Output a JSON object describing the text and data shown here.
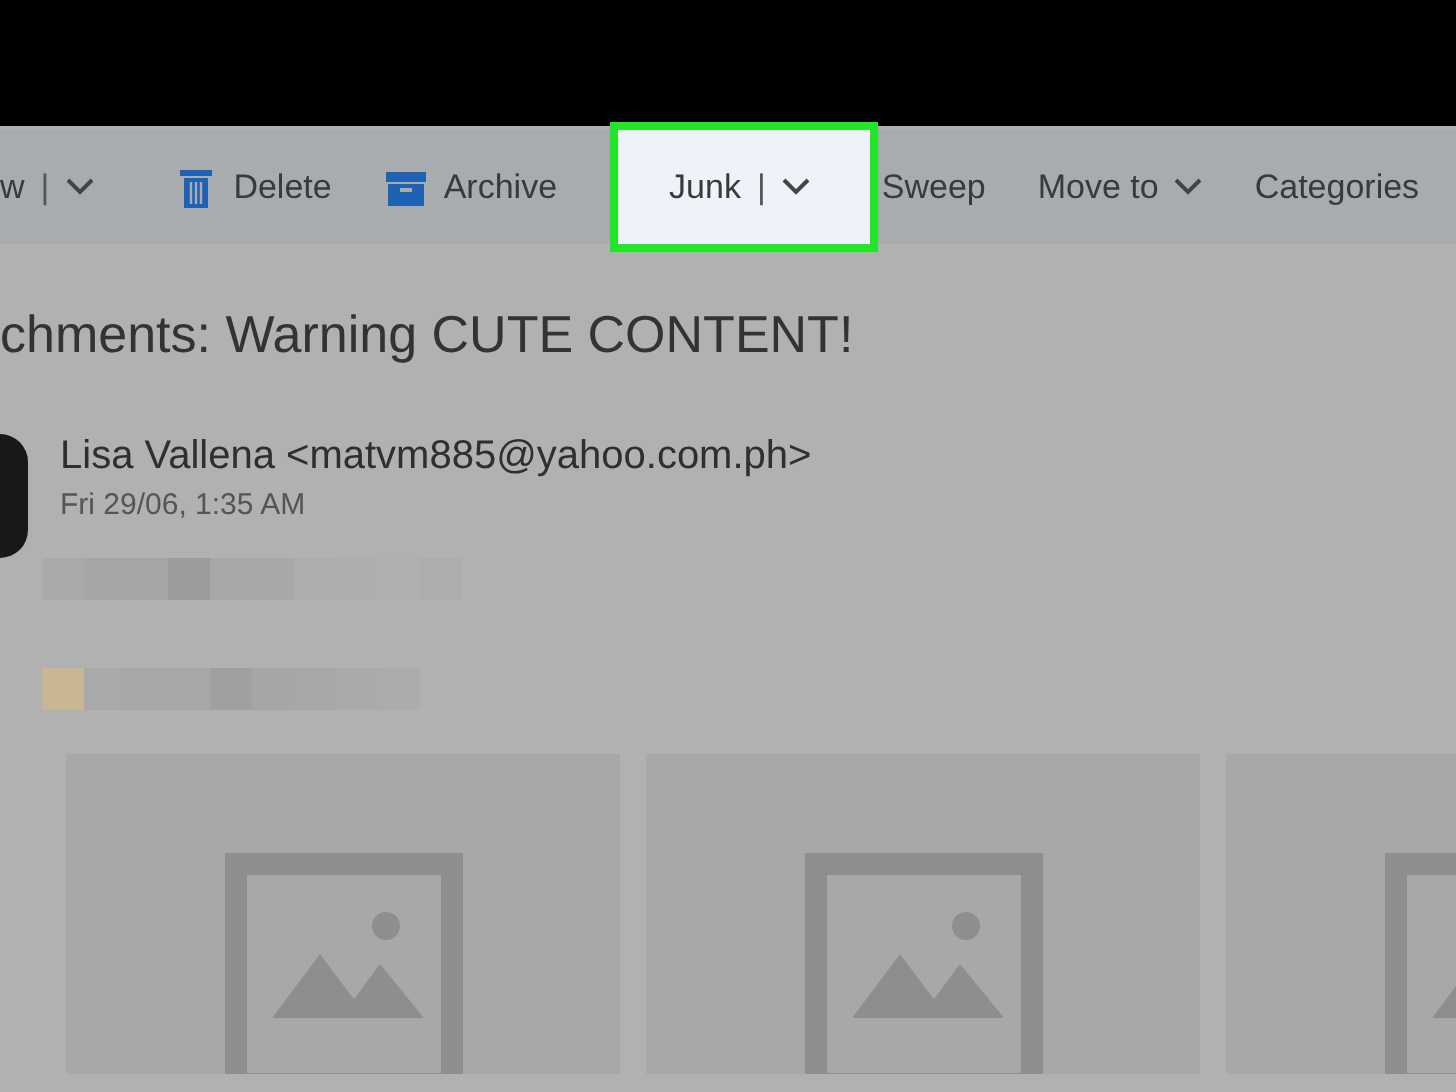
{
  "toolbar": {
    "items": [
      {
        "label": "w",
        "kind": "split",
        "separator": "|",
        "selected": false
      },
      {
        "label": "Delete",
        "kind": "delete",
        "selected": false
      },
      {
        "label": "Archive",
        "kind": "archive",
        "selected": false
      },
      {
        "label": "Junk",
        "kind": "split",
        "separator": "|",
        "selected": true
      },
      {
        "label": "Sweep",
        "kind": "plain",
        "selected": false
      },
      {
        "label": "Move to",
        "kind": "menu",
        "selected": false
      },
      {
        "label": "Categories",
        "kind": "plain",
        "selected": false
      }
    ]
  },
  "message": {
    "subject": "chments: Warning CUTE CONTENT!",
    "sender": "Lisa Vallena <matvm885@yahoo.com.ph>",
    "date": "Fri 29/06, 1:35 AM"
  }
}
